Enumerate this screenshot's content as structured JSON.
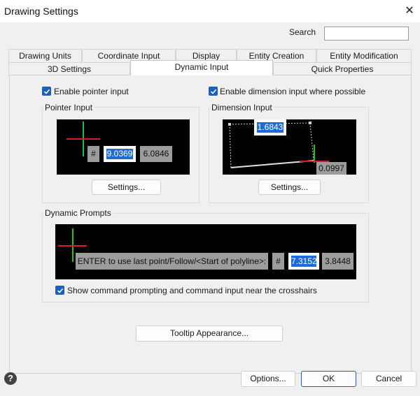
{
  "window": {
    "title": "Drawing Settings"
  },
  "search": {
    "label": "Search",
    "value": "",
    "placeholder": ""
  },
  "tabs_row1": [
    {
      "label": "Drawing Units"
    },
    {
      "label": "Coordinate Input"
    },
    {
      "label": "Display"
    },
    {
      "label": "Entity Creation"
    },
    {
      "label": "Entity Modification"
    }
  ],
  "tabs_row2": [
    {
      "label": "3D Settings"
    },
    {
      "label": "Dynamic Input",
      "active": true
    },
    {
      "label": "Quick Properties"
    }
  ],
  "pointer": {
    "enable_label": "Enable pointer input",
    "enabled": true,
    "group_title": "Pointer Input",
    "hash": "#",
    "x_value": "9.0369",
    "y_value": "6.0846",
    "settings_label": "Settings..."
  },
  "dimension": {
    "enable_label": "Enable dimension input where possible",
    "enabled": true,
    "group_title": "Dimension Input",
    "length_value": "1.6843",
    "second_value": "0.0997",
    "settings_label": "Settings..."
  },
  "prompts": {
    "group_title": "Dynamic Prompts",
    "prompt_text": "ENTER to use last point/Follow/<Start of polyline>:",
    "hash": "#",
    "x_value": "7.3152",
    "y_value": "3.8448",
    "show_label": "Show command prompting and command input near the crosshairs",
    "show_checked": true
  },
  "tooltip_button": {
    "label": "Tooltip Appearance..."
  },
  "footer": {
    "options_label": "Options...",
    "ok_label": "OK",
    "cancel_label": "Cancel"
  },
  "colors": {
    "accent": "#1b5fbf",
    "crosshair_green": "#22c322",
    "crosshair_red": "#d42020"
  }
}
